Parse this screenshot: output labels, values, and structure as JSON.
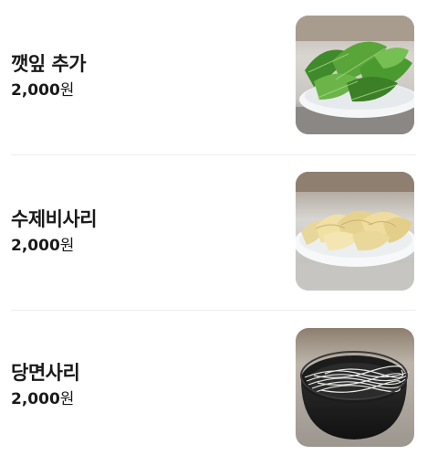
{
  "menu": {
    "items": [
      {
        "name": "깻잎 추가",
        "price": "2,000",
        "currency": "원",
        "image": "perilla-leaves-plate"
      },
      {
        "name": "수제비사리",
        "price": "2,000",
        "currency": "원",
        "image": "sujebi-dough-plate"
      },
      {
        "name": "당면사리",
        "price": "2,000",
        "currency": "원",
        "image": "glass-noodles-bowl"
      }
    ]
  },
  "colors": {
    "text": "#1a1a1a",
    "divider": "#ececec",
    "background": "#ffffff"
  }
}
